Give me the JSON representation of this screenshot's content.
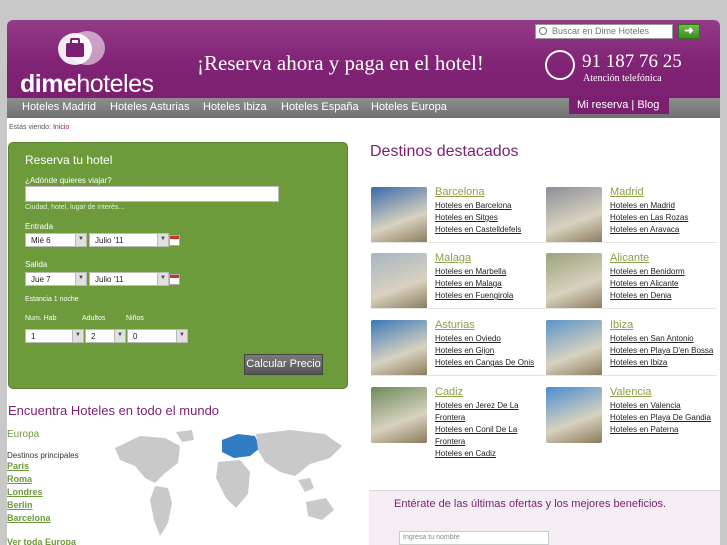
{
  "search": {
    "placeholder": "Buscar en Dime Hoteles",
    "go": "➜"
  },
  "header": {
    "logo_bold": "dime",
    "logo_thin": "hoteles",
    "slogan": "¡Reserva ahora y paga en el hotel!",
    "phone": "91 187 76 25",
    "phone_sub": "Atención telefónica"
  },
  "nav": {
    "items": [
      "Hoteles Madrid",
      "Hoteles Asturias",
      "Hoteles Ibiza",
      "Hoteles España",
      "Hoteles Europa"
    ],
    "myres": "Mi reserva",
    "sep": "|",
    "blog": "Blog"
  },
  "breadcrumb": {
    "label": "Estás viendo:",
    "home": "Inicio"
  },
  "booking": {
    "title": "Reserva tu hotel",
    "where_label": "¿Adónde quieres viajar?",
    "where_hint": "Ciudad, hotel, lugar de interés...",
    "checkin_label": "Entrada",
    "checkin_day": "Mié 6",
    "checkin_month": "Julio '11",
    "checkout_label": "Salida",
    "checkout_day": "Jue 7",
    "checkout_month": "Julio '11",
    "stay": "Estancia 1 noche",
    "rooms_label": "Num. Hab",
    "adults_label": "Adultos",
    "kids_label": "Niños",
    "rooms": "1",
    "adults": "2",
    "kids": "0",
    "calc": "Calcular Precio"
  },
  "world": {
    "title": "Encuentra Hoteles en todo el mundo",
    "region": "Europa",
    "dest_label": "Destinos principales",
    "cities": [
      "Paris",
      "Roma",
      "Londres",
      "Berlin",
      "Barcelona"
    ],
    "more": "Ver toda Europa"
  },
  "destinations": {
    "title": "Destinos destacados",
    "items": [
      {
        "name": "Barcelona",
        "links": [
          "Hoteles en Barcelona",
          "Hoteles en Sitges",
          "Hoteles en Castelldefels"
        ],
        "color": "#3b6aa8"
      },
      {
        "name": "Madrid",
        "links": [
          "Hoteles en Madrid",
          "Hoteles en Las Rozas",
          "Hoteles en Aravaca"
        ],
        "color": "#8a8f98"
      },
      {
        "name": "Malaga",
        "links": [
          "Hoteles en Marbella",
          "Hoteles en Malaga",
          "Hoteles en Fuengirola"
        ],
        "color": "#a8b4c2"
      },
      {
        "name": "Alicante",
        "links": [
          "Hoteles en Benidorm",
          "Hoteles en Alicante",
          "Hoteles en Denia"
        ],
        "color": "#9aa37a"
      },
      {
        "name": "Asturias",
        "links": [
          "Hoteles en Oviedo",
          "Hoteles en Gijon",
          "Hoteles en Cangas De Onis"
        ],
        "color": "#3a78b8"
      },
      {
        "name": "Ibiza",
        "links": [
          "Hoteles en San Antonio",
          "Hoteles en Playa D'en Bossa",
          "Hoteles en Ibiza"
        ],
        "color": "#5b94c8"
      },
      {
        "name": "Cadiz",
        "links": [
          "Hoteles en Jerez De La",
          "Frontera",
          "Hoteles en Conil De La",
          "Frontera",
          "Hoteles en Cadiz"
        ],
        "color": "#6d8a5a"
      },
      {
        "name": "Valencia",
        "links": [
          "Hoteles en Valencia",
          "Hoteles en Playa De Gandia",
          "Hoteles en Paterna"
        ],
        "color": "#4a8ccf"
      }
    ]
  },
  "newsletter": {
    "text": "Entérate de las últimas ofertas y los mejores beneficios.",
    "placeholder": "Ingresa tu nombre"
  }
}
